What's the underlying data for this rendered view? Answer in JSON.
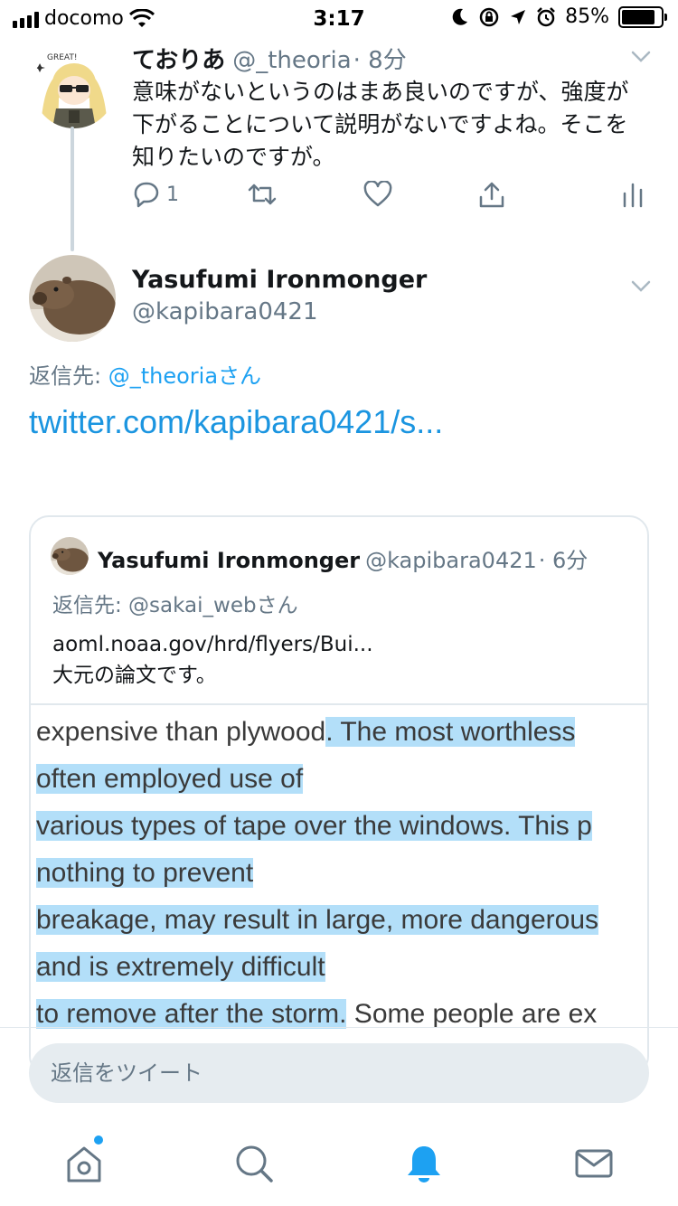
{
  "status_bar": {
    "carrier": "docomo",
    "time": "3:17",
    "battery": "85%",
    "battery_level": 0.85
  },
  "tweet1": {
    "name": "ておりあ",
    "handle": "@_theoria",
    "time": "· 8分",
    "text": "意味がないというのはまあ良いのですが、強度が下がることについて説明がないですよね。そこを知りたいのですが。",
    "reply_count": "1",
    "avatar_text": "GREAT!"
  },
  "tweet2": {
    "name": "Yasufumi Ironmonger",
    "handle": "@kapibara0421",
    "reply_prefix": "返信先: ",
    "reply_to": "@_theoriaさん",
    "link": "twitter.com/kapibara0421/s..."
  },
  "quote": {
    "name": "Yasufumi Ironmonger",
    "handle": "@kapibara0421",
    "time": "· 6分",
    "reply_line": "返信先: @sakai_webさん",
    "text_line1": "aoml.noaa.gov/hrd/flyers/Bui...",
    "text_line2": "大元の論文です。",
    "image_lines": [
      {
        "plain": "expensive than plywood",
        "highlight": ". The most worthless ",
        "tail": ""
      },
      {
        "plain": "",
        "highlight": "often employed use of",
        "tail": ""
      },
      {
        "plain": "",
        "highlight": "various types of tape over the windows. This p",
        "tail": ""
      },
      {
        "plain": "",
        "highlight": "nothing to prevent",
        "tail": ""
      },
      {
        "plain": "",
        "highlight": "breakage, may result in large, more dangerous",
        "tail": ""
      },
      {
        "plain": "",
        "highlight": "and is extremely difficult",
        "tail": ""
      },
      {
        "plain": "",
        "highlight": "to remove after the storm.",
        "tail": " Some people are ex"
      }
    ]
  },
  "reply_bar": {
    "placeholder": "返信をツイート"
  },
  "colors": {
    "accent": "#1da1f2",
    "link": "#1b95e0",
    "highlight": "#b3dff9",
    "muted": "#657786"
  }
}
